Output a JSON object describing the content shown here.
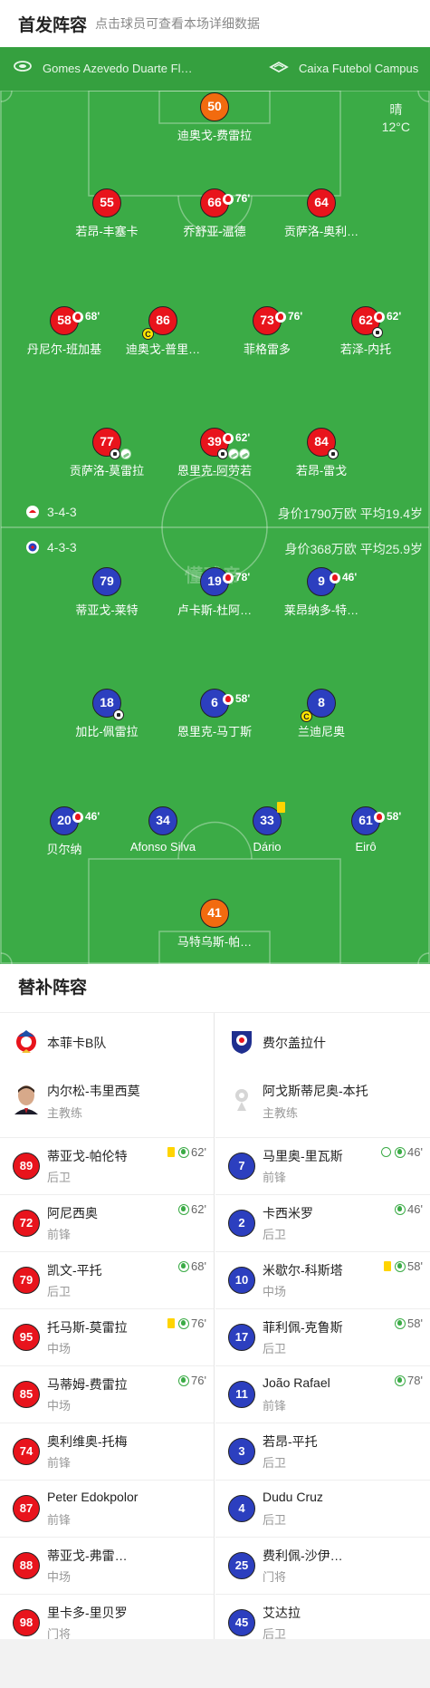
{
  "header": {
    "title": "首发阵容",
    "subtitle": "点击球员可查看本场详细数据"
  },
  "venue": {
    "left_text": "Gomes Azevedo Duarte Fl…",
    "right_text": "Caixa Futebol Campus"
  },
  "weather": {
    "condition": "晴",
    "temp": "12°C"
  },
  "watermark": "懂球帝",
  "home_team": {
    "formation": "3-4-3",
    "value_text": "身价1790万欧  平均19.4岁",
    "color": "#e8141c"
  },
  "away_team": {
    "formation": "4-3-3",
    "value_text": "身价368万欧   平均25.9岁",
    "color": "#2c3fbf"
  },
  "home_players": [
    {
      "num": "50",
      "name": "迪奥戈-费雷拉",
      "sub": ""
    },
    {
      "num": "55",
      "name": "若昂-丰塞卡",
      "sub": ""
    },
    {
      "num": "66",
      "name": "乔舒亚-温德",
      "sub": "76'"
    },
    {
      "num": "64",
      "name": "贡萨洛-奥利…",
      "sub": ""
    },
    {
      "num": "58",
      "name": "丹尼尔-班加基",
      "sub": "68'"
    },
    {
      "num": "86",
      "name": "迪奥戈-普里…",
      "sub": ""
    },
    {
      "num": "73",
      "name": "菲格雷多",
      "sub": "76'"
    },
    {
      "num": "62",
      "name": "若泽-内托",
      "sub": "62'"
    },
    {
      "num": "77",
      "name": "贡萨洛-莫雷拉",
      "sub": ""
    },
    {
      "num": "39",
      "name": "恩里克-阿劳若",
      "sub": "62'"
    },
    {
      "num": "84",
      "name": "若昂-雷戈",
      "sub": ""
    }
  ],
  "away_players": [
    {
      "num": "79",
      "name": "蒂亚戈-莱特",
      "sub": ""
    },
    {
      "num": "19",
      "name": "卢卡斯-杜阿…",
      "sub": "78'"
    },
    {
      "num": "9",
      "name": "莱昂纳多-特…",
      "sub": "46'"
    },
    {
      "num": "18",
      "name": "加比-佩雷拉",
      "sub": ""
    },
    {
      "num": "6",
      "name": "恩里克-马丁斯",
      "sub": "58'"
    },
    {
      "num": "8",
      "name": "兰迪尼奥",
      "sub": ""
    },
    {
      "num": "20",
      "name": "贝尔纳",
      "sub": "46'"
    },
    {
      "num": "34",
      "name": "Afonso Silva",
      "sub": ""
    },
    {
      "num": "33",
      "name": "Dário",
      "sub": ""
    },
    {
      "num": "61",
      "name": "Eirô",
      "sub": "58'"
    },
    {
      "num": "41",
      "name": "马特乌斯-帕…",
      "sub": ""
    }
  ],
  "subs": {
    "title": "替补阵容",
    "home": {
      "team_name": "本菲卡B队",
      "coach": {
        "name": "内尔松-韦里西莫",
        "role": "主教练"
      },
      "players": [
        {
          "num": "89",
          "name": "蒂亚戈-帕伦特",
          "pos": "后卫",
          "event": "62'"
        },
        {
          "num": "72",
          "name": "阿尼西奥",
          "pos": "前锋",
          "event": "62'"
        },
        {
          "num": "79",
          "name": "凯文-平托",
          "pos": "后卫",
          "event": "68'"
        },
        {
          "num": "95",
          "name": "托马斯-莫雷拉",
          "pos": "中场",
          "event": "76'"
        },
        {
          "num": "85",
          "name": "马蒂姆-费雷拉",
          "pos": "中场",
          "event": "76'"
        },
        {
          "num": "74",
          "name": "奥利维奥-托梅",
          "pos": "前锋",
          "event": ""
        },
        {
          "num": "87",
          "name": "Peter Edokpolor",
          "pos": "前锋",
          "event": ""
        },
        {
          "num": "88",
          "name": "蒂亚戈-弗雷…",
          "pos": "中场",
          "event": ""
        },
        {
          "num": "98",
          "name": "里卡多-里贝罗",
          "pos": "门将",
          "event": ""
        }
      ]
    },
    "away": {
      "team_name": "费尔盖拉什",
      "coach": {
        "name": "阿戈斯蒂尼奥-本托",
        "role": "主教练"
      },
      "players": [
        {
          "num": "7",
          "name": "马里奥-里瓦斯",
          "pos": "前锋",
          "event": "46'"
        },
        {
          "num": "2",
          "name": "卡西米罗",
          "pos": "后卫",
          "event": "46'"
        },
        {
          "num": "10",
          "name": "米歇尔-科斯塔",
          "pos": "中场",
          "event": "58'"
        },
        {
          "num": "17",
          "name": "菲利佩-克鲁斯",
          "pos": "后卫",
          "event": "58'"
        },
        {
          "num": "11",
          "name": "João Rafael",
          "pos": "前锋",
          "event": "78'"
        },
        {
          "num": "3",
          "name": "若昂-平托",
          "pos": "后卫",
          "event": ""
        },
        {
          "num": "4",
          "name": "Dudu Cruz",
          "pos": "后卫",
          "event": ""
        },
        {
          "num": "25",
          "name": "费利佩-沙伊…",
          "pos": "门将",
          "event": ""
        },
        {
          "num": "45",
          "name": "艾达拉",
          "pos": "后卫",
          "event": ""
        }
      ]
    }
  }
}
